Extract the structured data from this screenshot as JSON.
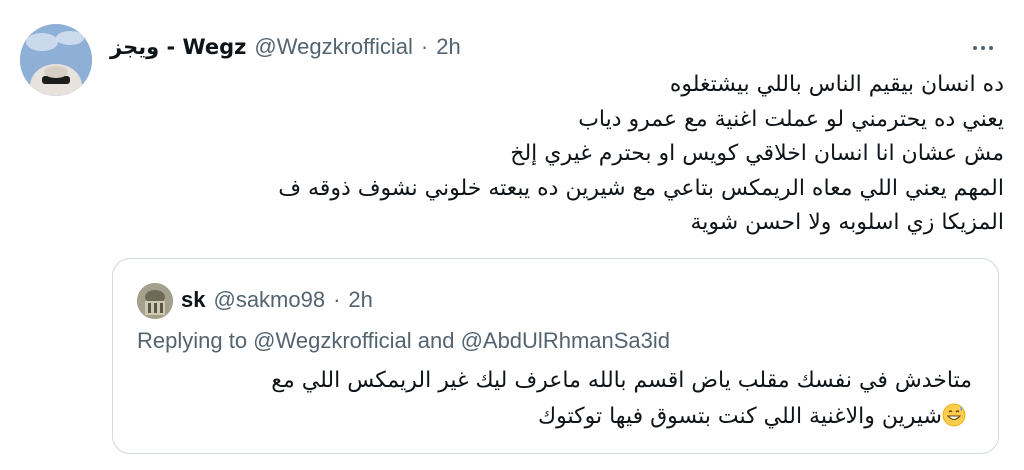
{
  "tweet": {
    "display_name": "ويجز - Wegz",
    "handle": "@Wegzkrofficial",
    "separator": "·",
    "time": "2h",
    "body_lines": [
      "ده انسان بيقيم الناس باللي بيشتغلوه",
      "يعني ده يحترمني لو عملت اغنية مع عمرو دياب",
      "مش عشان انا انسان اخلاقي كويس  او بحترم غيري إلخ",
      "المهم يعني اللي معاه الريمكس بتاعي مع شيرين ده يبعته خلوني نشوف ذوقه ف",
      "المزيكا زي اسلوبه ولا احسن شوية"
    ],
    "more_icon": "more-horizontal-icon"
  },
  "quoted": {
    "display_name": "sk",
    "handle": "@sakmo98",
    "separator": "·",
    "time": "2h",
    "replying": "Replying to @Wegzkrofficial and @AbdUlRhmanSa3id",
    "body_lines": [
      "متاخدش في نفسك مقلب ياض اقسم بالله ماعرف ليك غير الريمكس اللي مع",
      "شيرين والاغنية اللي كنت بتسوق فيها توكتوك"
    ],
    "emoji": "grinning-sweat-emoji"
  },
  "colors": {
    "text": "#0f1419",
    "secondary": "#536471",
    "border": "#cfd9de"
  }
}
